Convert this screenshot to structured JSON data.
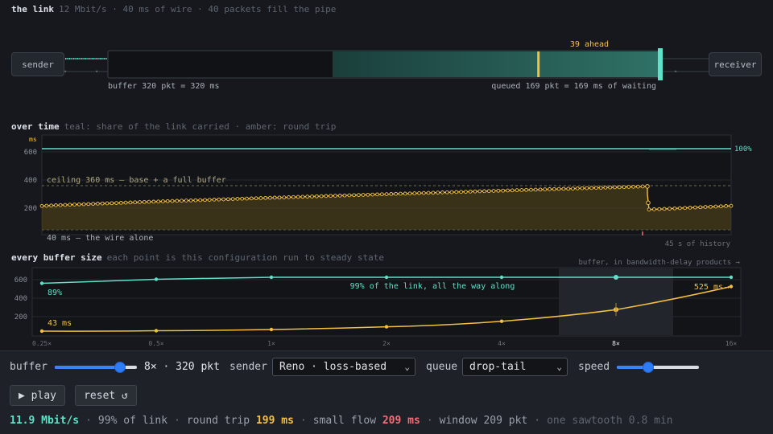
{
  "link": {
    "title": "the link",
    "subtitle": "12 Mbit/s · 40 ms of wire · 40 packets fill the pipe",
    "sender_label": "sender",
    "receiver_label": "receiver",
    "ahead_label": "39 ahead",
    "buffer_label": "buffer 320 pkt = 320 ms",
    "queued_label": "queued 169 pkt = 169 ms of waiting",
    "buffer_capacity_pkt": 320,
    "queued_pkt": 169,
    "ahead_pkt": 39,
    "colors": {
      "queue": "#2e6e63",
      "marker": "#f5c042",
      "edge": "#5fe0c8"
    }
  },
  "over_time": {
    "title": "over time",
    "subtitle": "teal: share of the link carried · amber: round trip",
    "unit": "ms",
    "yticks": [
      "600",
      "400",
      "200"
    ],
    "ceiling_label": "ceiling 360 ms — base + a full buffer",
    "floor_label": "40 ms — the wire alone",
    "share_label": "100%",
    "history_label": "45 s of history"
  },
  "every_buffer": {
    "title": "every buffer size",
    "subtitle": "each point is this configuration run to steady state",
    "axis_note": "buffer, in bandwidth-delay products →",
    "share_note": "99% of the link, all the way along",
    "left_share_label": "89%",
    "left_rtt_label": "43 ms",
    "right_rtt_label": "525 ms",
    "yticks": [
      "600",
      "400",
      "200"
    ],
    "xticks": [
      "0.25×",
      "0.5×",
      "1×",
      "2×",
      "4×",
      "8×",
      "16×"
    ]
  },
  "chart_data": [
    {
      "type": "line",
      "title": "over time",
      "x_label": "45 s of history",
      "y_unit": "ms",
      "ylim": [
        40,
        660
      ],
      "series": [
        {
          "values_ms": [
            210,
            260,
            300,
            340,
            360,
            190,
            210
          ],
          "x_s": [
            0,
            9,
            18,
            27,
            34,
            35,
            45
          ]
        }
      ],
      "reference_lines_ms": [
        360,
        40
      ],
      "share_percent": 100
    },
    {
      "type": "line",
      "title": "every buffer size",
      "categories": [
        "0.25×",
        "0.5×",
        "1×",
        "2×",
        "4×",
        "8×",
        "16×"
      ],
      "series": [
        {
          "values": [
            550,
            590,
            610,
            610,
            610,
            610,
            610
          ]
        },
        {
          "values": [
            43,
            47,
            60,
            90,
            150,
            275,
            525
          ]
        }
      ],
      "ylim": [
        0,
        700
      ],
      "share_values_percent": [
        89,
        96,
        99,
        99,
        99,
        99,
        99
      ],
      "rtt_values_ms": [
        43,
        47,
        60,
        90,
        150,
        275,
        525
      ],
      "highlight_category": "8×"
    }
  ],
  "controls": {
    "buffer_label": "buffer",
    "buffer_value": "8× · 320 pkt",
    "buffer_fraction": 0.75,
    "sender_label": "sender",
    "sender_value": "Reno · loss-based",
    "queue_label": "queue",
    "queue_value": "drop-tail",
    "speed_label": "speed",
    "speed_fraction": 0.5,
    "play_label": "▶ play",
    "reset_label": "reset ↺"
  },
  "stats": {
    "throughput": "11.9 Mbit/s",
    "share": "99% of link",
    "rtt_label": "round trip",
    "rtt_value": "199 ms",
    "small_flow_label": "small flow",
    "small_flow_value": "209 ms",
    "window": "window 209 pkt",
    "sawtooth": "one sawtooth 0.8 min"
  }
}
